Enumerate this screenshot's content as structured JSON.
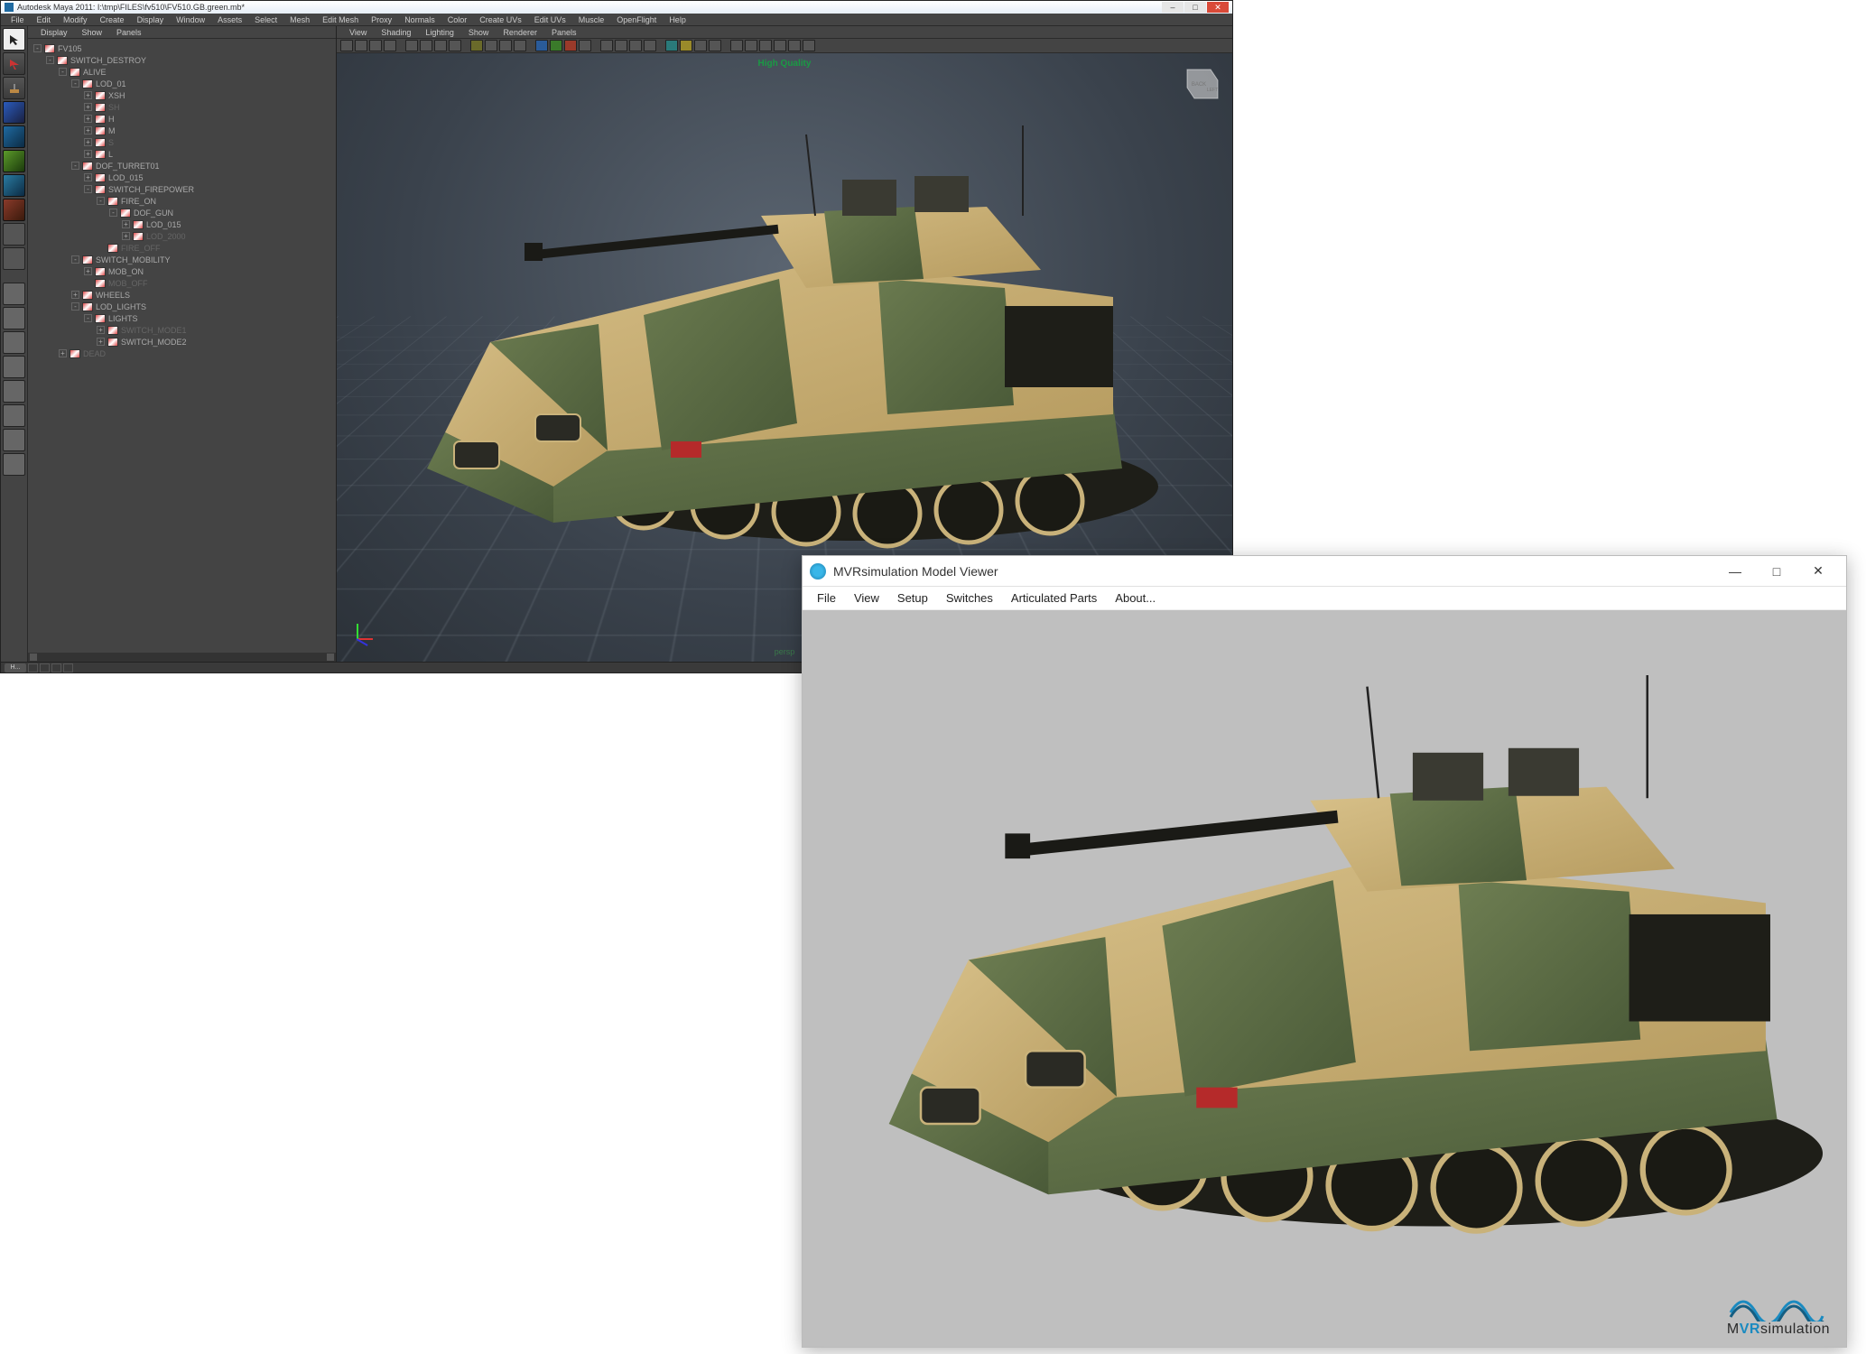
{
  "maya": {
    "title": "Autodesk Maya 2011: I:\\tmp\\FILES\\fv510\\FV510.GB.green.mb*",
    "window_buttons": {
      "min": "–",
      "max": "□",
      "close": "✕"
    },
    "menus": [
      "File",
      "Edit",
      "Modify",
      "Create",
      "Display",
      "Window",
      "Assets",
      "Select",
      "Mesh",
      "Edit Mesh",
      "Proxy",
      "Normals",
      "Color",
      "Create UVs",
      "Edit UVs",
      "Muscle",
      "OpenFlight",
      "Help"
    ],
    "outliner": {
      "menus": [
        "Display",
        "Show",
        "Panels"
      ],
      "tree": [
        {
          "depth": 0,
          "exp": "-",
          "label": "FV105",
          "dim": false
        },
        {
          "depth": 1,
          "exp": "-",
          "label": "SWITCH_DESTROY",
          "dim": false
        },
        {
          "depth": 2,
          "exp": "-",
          "label": "ALIVE",
          "dim": false
        },
        {
          "depth": 3,
          "exp": "-",
          "label": "LOD_01",
          "dim": false
        },
        {
          "depth": 4,
          "exp": "+",
          "label": "XSH",
          "dim": false
        },
        {
          "depth": 4,
          "exp": "+",
          "label": "SH",
          "dim": true
        },
        {
          "depth": 4,
          "exp": "+",
          "label": "H",
          "dim": false
        },
        {
          "depth": 4,
          "exp": "+",
          "label": "M",
          "dim": false
        },
        {
          "depth": 4,
          "exp": "+",
          "label": "S",
          "dim": true
        },
        {
          "depth": 4,
          "exp": "+",
          "label": "L",
          "dim": false
        },
        {
          "depth": 3,
          "exp": "-",
          "label": "DOF_TURRET01",
          "dim": false
        },
        {
          "depth": 4,
          "exp": "+",
          "label": "LOD_015",
          "dim": false
        },
        {
          "depth": 4,
          "exp": "-",
          "label": "SWITCH_FIREPOWER",
          "dim": false
        },
        {
          "depth": 5,
          "exp": "-",
          "label": "FIRE_ON",
          "dim": false
        },
        {
          "depth": 6,
          "exp": "-",
          "label": "DOF_GUN",
          "dim": false
        },
        {
          "depth": 7,
          "exp": "+",
          "label": "LOD_015",
          "dim": false
        },
        {
          "depth": 7,
          "exp": "+",
          "label": "LOD_2000",
          "dim": true
        },
        {
          "depth": 5,
          "exp": "",
          "label": "FIRE_OFF",
          "dim": true
        },
        {
          "depth": 3,
          "exp": "-",
          "label": "SWITCH_MOBILITY",
          "dim": false
        },
        {
          "depth": 4,
          "exp": "+",
          "label": "MOB_ON",
          "dim": false
        },
        {
          "depth": 4,
          "exp": "",
          "label": "MOB_OFF",
          "dim": true
        },
        {
          "depth": 3,
          "exp": "+",
          "label": "WHEELS",
          "dim": false
        },
        {
          "depth": 3,
          "exp": "-",
          "label": "LOD_LIGHTS",
          "dim": false
        },
        {
          "depth": 4,
          "exp": "-",
          "label": "LIGHTS",
          "dim": false
        },
        {
          "depth": 5,
          "exp": "+",
          "label": "SWITCH_MODE1",
          "dim": true
        },
        {
          "depth": 5,
          "exp": "+",
          "label": "SWITCH_MODE2",
          "dim": false
        },
        {
          "depth": 2,
          "exp": "+",
          "label": "DEAD",
          "dim": true
        }
      ]
    },
    "viewport": {
      "menus": [
        "View",
        "Shading",
        "Lighting",
        "Show",
        "Renderer",
        "Panels"
      ],
      "quality_label": "High Quality",
      "camera_label": "persp",
      "viewcube": {
        "back": "BACK",
        "left": "LEFT"
      }
    },
    "status": {
      "tab": "H..."
    }
  },
  "modelviewer": {
    "title": "MVRsimulation Model Viewer",
    "window_buttons": {
      "min": "—",
      "max": "□",
      "close": "✕"
    },
    "menus": [
      "File",
      "View",
      "Setup",
      "Switches",
      "Articulated Parts",
      "About..."
    ],
    "logo": {
      "prefix": "M",
      "brand": "VR",
      "suffix": "simulation"
    }
  }
}
